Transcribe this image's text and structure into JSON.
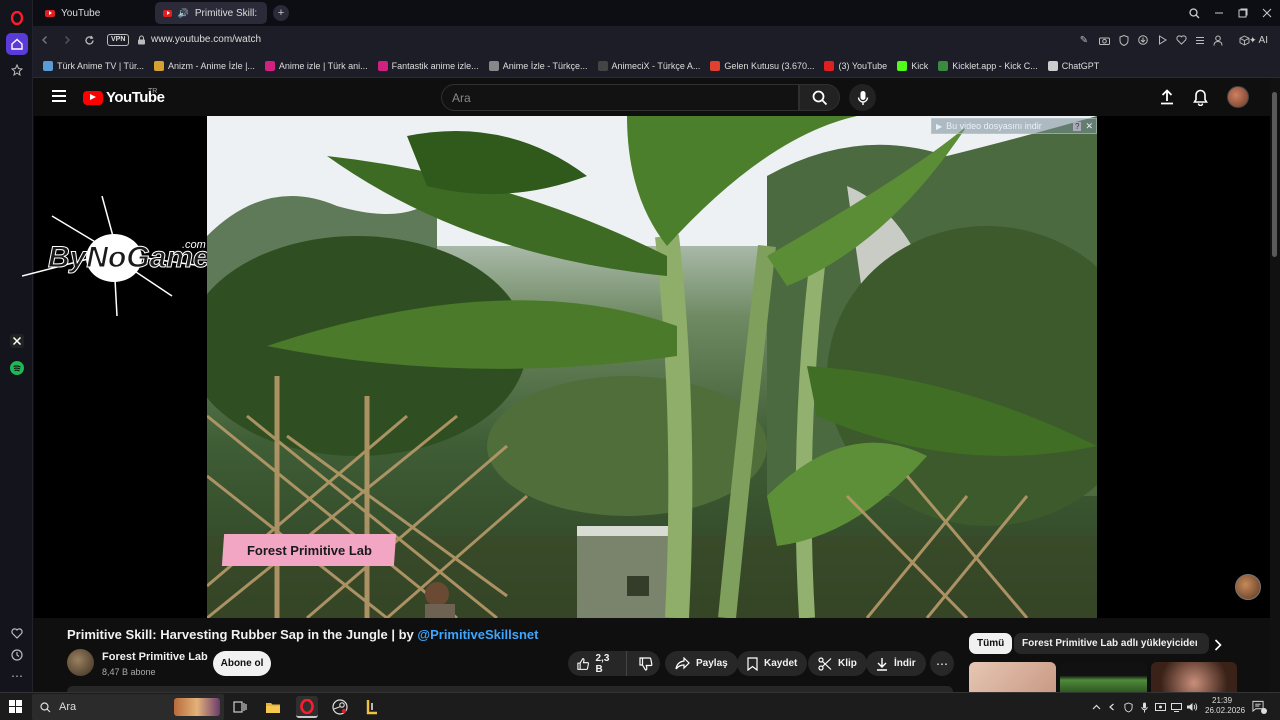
{
  "browser": {
    "tabs": [
      {
        "label": "YouTube"
      },
      {
        "label": "Primitive Skill: Harvest"
      }
    ],
    "new_tab": "+",
    "vpn": "VPN",
    "url": "www.youtube.com/watch",
    "ai_label": "AI"
  },
  "bookmarks": [
    {
      "label": "Türk Anime TV | Tür...",
      "color": "#5a9ad6"
    },
    {
      "label": "Anizm - Anime İzle |...",
      "color": "#d8a030"
    },
    {
      "label": "Anime izle | Türk ani...",
      "color": "#d02080"
    },
    {
      "label": "Fantastik anime izle...",
      "color": "#d02080"
    },
    {
      "label": "Anime İzle - Türkçe...",
      "color": "#888888"
    },
    {
      "label": "AnimeciX - Türkçe A...",
      "color": "#444444"
    },
    {
      "label": "Gelen Kutusu (3.670...",
      "color": "#e04030"
    },
    {
      "label": "(3) YouTube",
      "color": "#e02020"
    },
    {
      "label": "Kick",
      "color": "#53fc18"
    },
    {
      "label": "Kicklet.app - Kick C...",
      "color": "#3a8a40"
    },
    {
      "label": "ChatGPT",
      "color": "#cccccc"
    }
  ],
  "youtube": {
    "logo_text": "YouTube",
    "country": "TR",
    "search_placeholder": "Ara"
  },
  "player": {
    "brand_overlay": "Forest Primitive Lab",
    "download_hint": "Bu video dosyasını indir",
    "watermark_text": "ByNoGame",
    "watermark_suffix": ".com"
  },
  "video": {
    "title": "Primitive Skill: Harvesting Rubber Sap in the Jungle | by",
    "handle": "@PrimitiveSkillsnet",
    "channel_name": "Forest Primitive Lab",
    "subscribers": "8,47 B abone",
    "subscribe_label": "Abone ol",
    "likes": "2,3 B",
    "share_label": "Paylaş",
    "save_label": "Kaydet",
    "clip_label": "Klip",
    "download_label": "İndir"
  },
  "chips": {
    "all": "Tümü",
    "uploader": "Forest Primitive Lab adlı yükleyiciden"
  },
  "taskbar": {
    "search_label": "Ara",
    "time": "21:39",
    "date": "26.02.2026"
  },
  "colors": {
    "youtube_red": "#ff0000",
    "opera_red": "#ff1b2d",
    "link_blue": "#3ea6ff"
  }
}
